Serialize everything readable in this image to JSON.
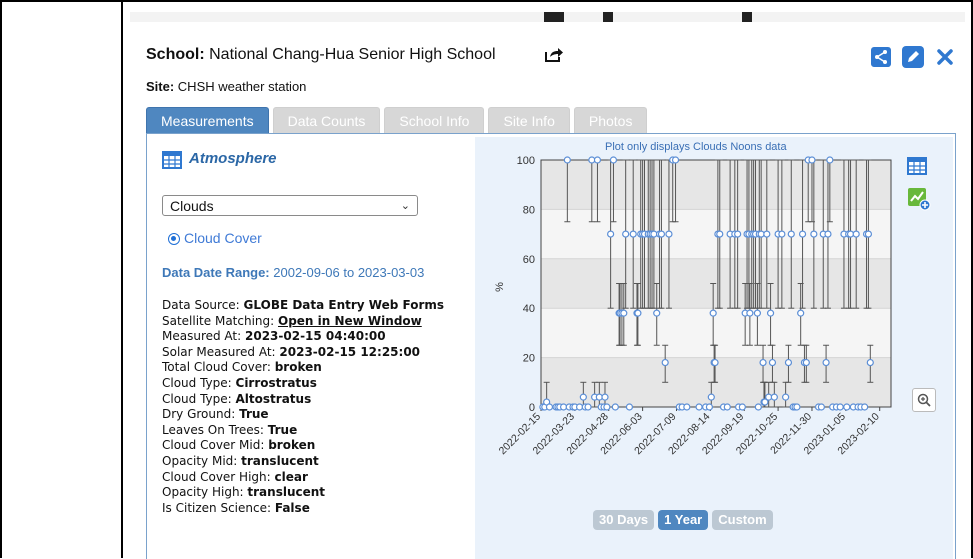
{
  "header": {
    "school_label": "School:",
    "school_name": "National Chang-Hua Senior High School",
    "site_label": "Site:",
    "site_name": "CHSH weather station"
  },
  "tabs": [
    {
      "label": "Measurements",
      "active": true
    },
    {
      "label": "Data Counts",
      "active": false
    },
    {
      "label": "School Info",
      "active": false
    },
    {
      "label": "Site Info",
      "active": false
    },
    {
      "label": "Photos",
      "active": false
    }
  ],
  "section": {
    "title": "Atmosphere",
    "select_value": "Clouds",
    "radio_label": "Cloud Cover",
    "range_label": "Data Date Range:",
    "range_value": "2002-09-06 to 2023-03-03"
  },
  "details": [
    {
      "key": "Data Source: ",
      "value": "GLOBE Data Entry Web Forms"
    },
    {
      "key": "Satellite Matching: ",
      "value": "Open in New Window",
      "link": true
    },
    {
      "key": "Measured At: ",
      "value": "2023-02-15 04:40:00"
    },
    {
      "key": "Solar Measured At: ",
      "value": "2023-02-15 12:25:00"
    },
    {
      "key": "Total Cloud Cover: ",
      "value": "broken"
    },
    {
      "key": "Cloud Type: ",
      "value": "Cirrostratus"
    },
    {
      "key": "Cloud Type: ",
      "value": "Altostratus"
    },
    {
      "key": "Dry Ground: ",
      "value": "True"
    },
    {
      "key": "Leaves On Trees: ",
      "value": "True"
    },
    {
      "key": "Cloud Cover Mid: ",
      "value": "broken"
    },
    {
      "key": "Opacity Mid: ",
      "value": "translucent"
    },
    {
      "key": "Cloud Cover High: ",
      "value": "clear"
    },
    {
      "key": "Opacity High: ",
      "value": "translucent"
    },
    {
      "key": "Is Citizen Science: ",
      "value": "False"
    }
  ],
  "chart": {
    "note": "Plot only displays Clouds Noons data",
    "ylabel": "%",
    "ylim": [
      0,
      100
    ],
    "yticks": [
      0,
      20,
      40,
      60,
      80,
      100
    ],
    "xticks": [
      "2022-02-15",
      "2022-03-23",
      "2022-04-28",
      "2022-06-03",
      "2022-07-09",
      "2022-08-14",
      "2022-09-19",
      "2022-10-25",
      "2022-11-30",
      "2023-01-05",
      "2023-02-10"
    ]
  },
  "chart_data": {
    "type": "scatter",
    "ylabel": "%",
    "ylim": [
      0,
      100
    ],
    "x_range": [
      "2022-02-15",
      "2023-02-22"
    ],
    "grid": true,
    "series": [
      {
        "name": "",
        "values": [
          [
            2,
            0
          ],
          [
            4,
            0
          ],
          [
            6,
            2
          ],
          [
            9,
            0
          ],
          [
            16,
            0
          ],
          [
            18,
            0
          ],
          [
            20,
            0
          ],
          [
            24,
            0
          ],
          [
            28,
            100
          ],
          [
            30,
            0
          ],
          [
            34,
            0
          ],
          [
            36,
            0
          ],
          [
            41,
            0
          ],
          [
            45,
            4
          ],
          [
            47,
            0
          ],
          [
            50,
            0
          ],
          [
            54,
            100
          ],
          [
            57,
            4
          ],
          [
            60,
            100
          ],
          [
            62,
            4
          ],
          [
            64,
            0
          ],
          [
            67,
            0
          ],
          [
            68,
            4
          ],
          [
            70,
            0
          ],
          [
            74,
            70
          ],
          [
            77,
            100
          ],
          [
            79,
            0
          ],
          [
            83,
            38
          ],
          [
            84,
            38
          ],
          [
            86,
            38
          ],
          [
            88,
            38
          ],
          [
            90,
            70
          ],
          [
            94,
            0
          ],
          [
            98,
            70
          ],
          [
            102,
            38
          ],
          [
            103,
            38
          ],
          [
            106,
            70
          ],
          [
            108,
            70
          ],
          [
            110,
            70
          ],
          [
            114,
            70
          ],
          [
            116,
            70
          ],
          [
            118,
            70
          ],
          [
            120,
            70
          ],
          [
            123,
            38
          ],
          [
            126,
            70
          ],
          [
            128,
            70
          ],
          [
            132,
            18
          ],
          [
            136,
            70
          ],
          [
            140,
            100
          ],
          [
            143,
            100
          ],
          [
            147,
            0
          ],
          [
            150,
            0
          ],
          [
            155,
            0
          ],
          [
            168,
            0
          ],
          [
            175,
            0
          ],
          [
            179,
            0
          ],
          [
            181,
            4
          ],
          [
            183,
            38
          ],
          [
            184,
            18
          ],
          [
            185,
            18
          ],
          [
            188,
            70
          ],
          [
            190,
            70
          ],
          [
            194,
            0
          ],
          [
            198,
            0
          ],
          [
            201,
            70
          ],
          [
            206,
            70
          ],
          [
            209,
            70
          ],
          [
            210,
            0
          ],
          [
            214,
            0
          ],
          [
            217,
            38
          ],
          [
            219,
            70
          ],
          [
            221,
            70
          ],
          [
            222,
            38
          ],
          [
            224,
            70
          ],
          [
            226,
            70
          ],
          [
            228,
            70
          ],
          [
            230,
            38
          ],
          [
            231,
            0
          ],
          [
            232,
            70
          ],
          [
            234,
            70
          ],
          [
            236,
            18
          ],
          [
            237,
            2
          ],
          [
            238,
            2
          ],
          [
            240,
            70
          ],
          [
            242,
            4
          ],
          [
            244,
            38
          ],
          [
            246,
            18
          ],
          [
            248,
            4
          ],
          [
            252,
            70
          ],
          [
            256,
            70
          ],
          [
            260,
            4
          ],
          [
            263,
            18
          ],
          [
            266,
            70
          ],
          [
            268,
            0
          ],
          [
            270,
            0
          ],
          [
            272,
            0
          ],
          [
            276,
            38
          ],
          [
            278,
            70
          ],
          [
            280,
            18
          ],
          [
            282,
            18
          ],
          [
            284,
            100
          ],
          [
            288,
            100
          ],
          [
            290,
            70
          ],
          [
            295,
            0
          ],
          [
            298,
            0
          ],
          [
            300,
            70
          ],
          [
            303,
            18
          ],
          [
            305,
            70
          ],
          [
            307,
            100
          ],
          [
            310,
            0
          ],
          [
            314,
            0
          ],
          [
            318,
            0
          ],
          [
            322,
            70
          ],
          [
            325,
            0
          ],
          [
            327,
            70
          ],
          [
            329,
            70
          ],
          [
            332,
            0
          ],
          [
            335,
            70
          ],
          [
            337,
            0
          ],
          [
            340,
            0
          ],
          [
            344,
            0
          ],
          [
            346,
            70
          ],
          [
            348,
            70
          ],
          [
            350,
            18
          ]
        ]
      }
    ]
  },
  "range_buttons": [
    {
      "label": "30 Days",
      "active": false
    },
    {
      "label": "1 Year",
      "active": true
    },
    {
      "label": "Custom",
      "active": false
    }
  ],
  "colors": {
    "accent": "#4f87c0",
    "tab_inactive": "#d7d7d7",
    "chart_bg": "#eaf2fb",
    "point": "#5b8ed6"
  }
}
